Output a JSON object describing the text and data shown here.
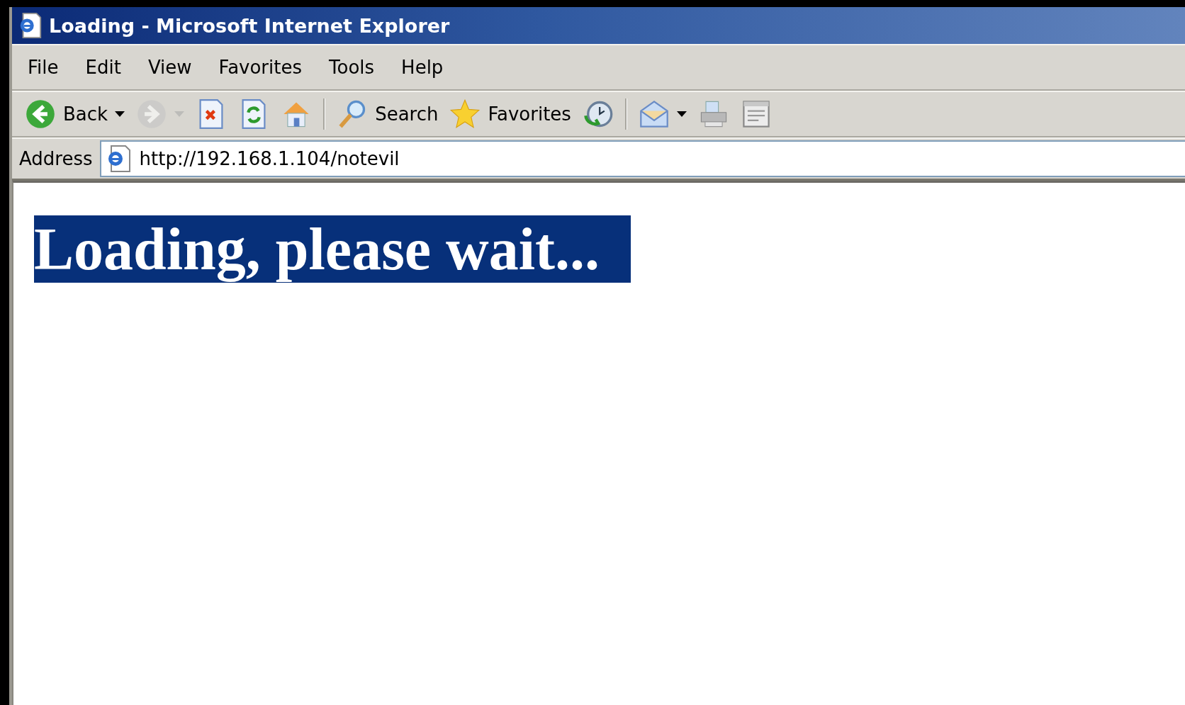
{
  "window": {
    "title": "Loading - Microsoft Internet Explorer"
  },
  "menu": [
    "File",
    "Edit",
    "View",
    "Favorites",
    "Tools",
    "Help"
  ],
  "toolbar": [
    {
      "kind": "back",
      "label": "Back",
      "dropdown": true,
      "disabled": false
    },
    {
      "kind": "forward",
      "dropdown": true,
      "disabled": true
    },
    {
      "kind": "stop",
      "dropdown": false,
      "disabled": false
    },
    {
      "kind": "refresh",
      "dropdown": false,
      "disabled": false
    },
    {
      "kind": "home",
      "dropdown": false,
      "disabled": false
    },
    {
      "kind": "separator"
    },
    {
      "kind": "search",
      "label": "Search",
      "dropdown": false,
      "disabled": false
    },
    {
      "kind": "favorites",
      "label": "Favorites",
      "dropdown": false,
      "disabled": false
    },
    {
      "kind": "history",
      "dropdown": false,
      "disabled": false
    },
    {
      "kind": "separator"
    },
    {
      "kind": "mail",
      "dropdown": true,
      "disabled": false
    },
    {
      "kind": "print",
      "dropdown": false,
      "disabled": false
    },
    {
      "kind": "edit",
      "dropdown": false,
      "disabled": false
    }
  ],
  "address": {
    "label": "Address",
    "value": "http://192.168.1.104/notevil"
  },
  "page": {
    "heading": "Loading, please wait..."
  }
}
